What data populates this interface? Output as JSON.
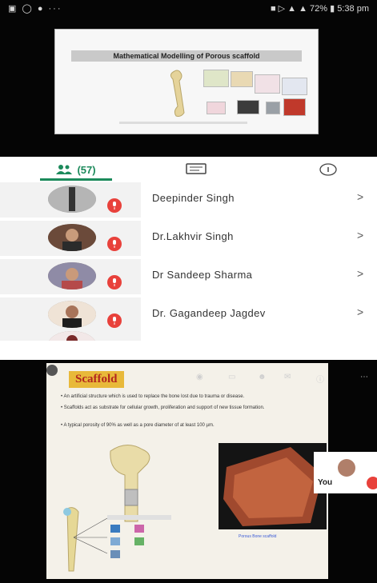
{
  "status_bar": {
    "battery": "72%",
    "time": "5:38 pm"
  },
  "shared_slide": {
    "title": "Mathematical Modelling of Porous scaffold"
  },
  "tabs": {
    "participants_count": "(57)"
  },
  "participants": [
    {
      "name": "Deepinder Singh"
    },
    {
      "name": "Dr.Lakhvir Singh"
    },
    {
      "name": "Dr Sandeep Sharma"
    },
    {
      "name": "Dr. Gagandeep Jagdev"
    }
  ],
  "presentation": {
    "title": "Scaffold",
    "bullet_1": "An artificial structure which is used to replace the bone lost due to trauma or disease.",
    "bullet_2": "Scaffolds act as substrate for cellular growth, proliferation and support of new tissue formation.",
    "bullet_3": "A typical porosity of 90% as well as a pore diameter of at least 100 µm.",
    "micro_caption": "Porous Bone scaffold"
  },
  "self_view": {
    "label": "You"
  },
  "colors": {
    "accent_green": "#1c8a5b",
    "mic_red": "#e8413b",
    "scaffold_title_bg": "#e8b93a"
  }
}
